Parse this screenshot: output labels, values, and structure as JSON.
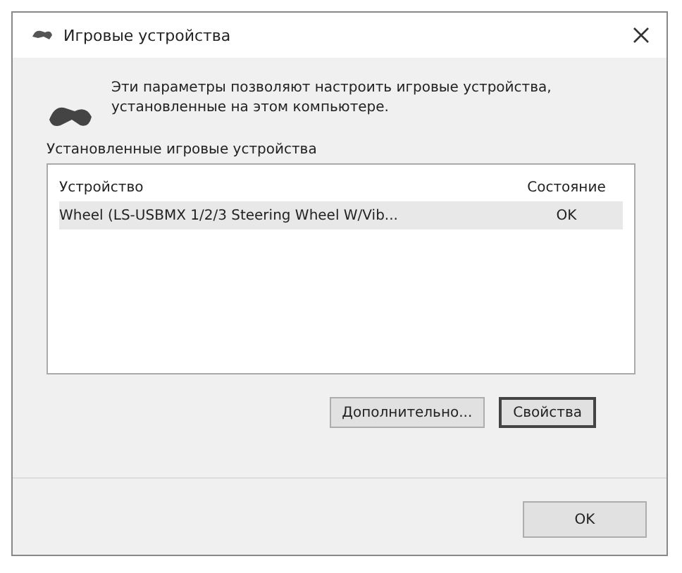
{
  "window": {
    "title": "Игровые устройства"
  },
  "description": "Эти параметры позволяют настроить игровые устройства, установленные на этом компьютере.",
  "group": {
    "label": "Установленные игровые устройства"
  },
  "table": {
    "columns": [
      "Устройство",
      "Состояние"
    ],
    "rows": [
      {
        "device": "Wheel (LS-USBMX 1/2/3 Steering Wheel W/Vib...",
        "status": "OK",
        "selected": true
      }
    ]
  },
  "buttons": [
    {
      "label": "Дополнительно...",
      "default": false
    },
    {
      "label": "Свойства",
      "default": true
    }
  ],
  "footer_buttons": [
    {
      "label": "OK",
      "default": false
    }
  ]
}
